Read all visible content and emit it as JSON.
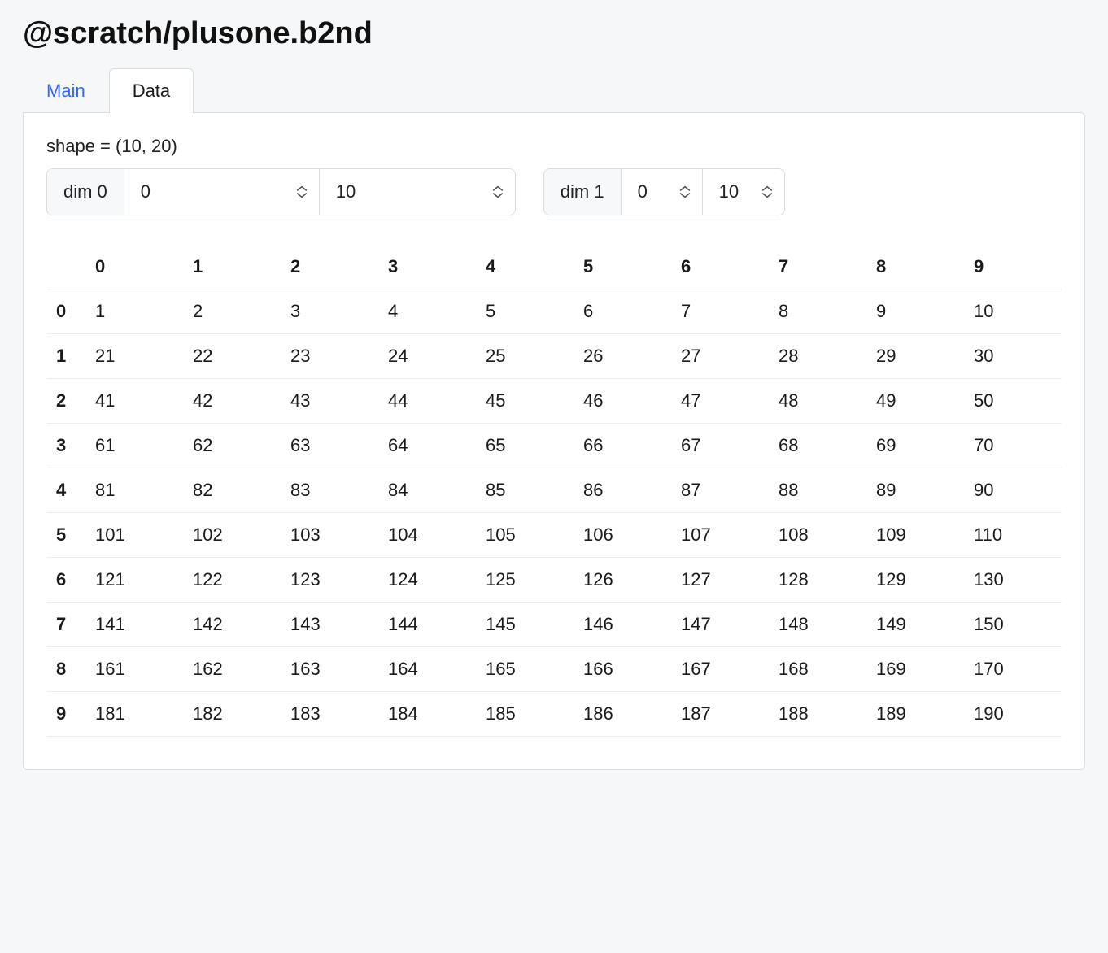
{
  "page_title": "@scratch/plusone.b2nd",
  "tabs": [
    {
      "label": "Main",
      "active": false
    },
    {
      "label": "Data",
      "active": true
    }
  ],
  "shape_text": "shape = (10, 20)",
  "dims": [
    {
      "label": "dim 0",
      "start": "0",
      "stop": "10",
      "wide": true
    },
    {
      "label": "dim 1",
      "start": "0",
      "stop": "10",
      "wide": false
    }
  ],
  "table": {
    "col_headers": [
      "0",
      "1",
      "2",
      "3",
      "4",
      "5",
      "6",
      "7",
      "8",
      "9"
    ],
    "row_headers": [
      "0",
      "1",
      "2",
      "3",
      "4",
      "5",
      "6",
      "7",
      "8",
      "9"
    ],
    "rows": [
      [
        1,
        2,
        3,
        4,
        5,
        6,
        7,
        8,
        9,
        10
      ],
      [
        21,
        22,
        23,
        24,
        25,
        26,
        27,
        28,
        29,
        30
      ],
      [
        41,
        42,
        43,
        44,
        45,
        46,
        47,
        48,
        49,
        50
      ],
      [
        61,
        62,
        63,
        64,
        65,
        66,
        67,
        68,
        69,
        70
      ],
      [
        81,
        82,
        83,
        84,
        85,
        86,
        87,
        88,
        89,
        90
      ],
      [
        101,
        102,
        103,
        104,
        105,
        106,
        107,
        108,
        109,
        110
      ],
      [
        121,
        122,
        123,
        124,
        125,
        126,
        127,
        128,
        129,
        130
      ],
      [
        141,
        142,
        143,
        144,
        145,
        146,
        147,
        148,
        149,
        150
      ],
      [
        161,
        162,
        163,
        164,
        165,
        166,
        167,
        168,
        169,
        170
      ],
      [
        181,
        182,
        183,
        184,
        185,
        186,
        187,
        188,
        189,
        190
      ]
    ]
  }
}
